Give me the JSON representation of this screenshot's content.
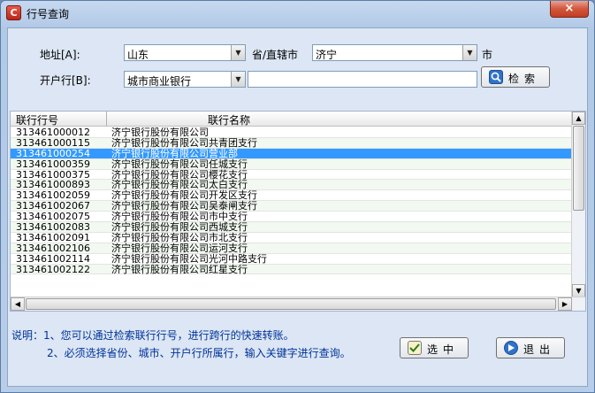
{
  "window": {
    "title": "行号查询",
    "app_icon_glyph": "C",
    "close_glyph": "×"
  },
  "form": {
    "address_label": "地址[A]:",
    "province_value": "山东",
    "province_suffix": "省/直辖市",
    "city_value": "济宁",
    "city_suffix": "市",
    "bank_label": "开户行[B]:",
    "bank_type_value": "城市商业银行",
    "keyword_value": "",
    "search_button": "检索"
  },
  "table": {
    "headers": [
      "联行行号",
      "联行名称"
    ],
    "selected_index": 2,
    "rows": [
      [
        "313461000012",
        "济宁银行股份有限公司"
      ],
      [
        "313461000115",
        "济宁银行股份有限公司共青团支行"
      ],
      [
        "313461000254",
        "济宁银行股份有限公司营业部"
      ],
      [
        "313461000359",
        "济宁银行股份有限公司任城支行"
      ],
      [
        "313461000375",
        "济宁银行股份有限公司樱花支行"
      ],
      [
        "313461000893",
        "济宁银行股份有限公司太白支行"
      ],
      [
        "313461002059",
        "济宁银行股份有限公司开发区支行"
      ],
      [
        "313461002067",
        "济宁银行股份有限公司吴泰闸支行"
      ],
      [
        "313461002075",
        "济宁银行股份有限公司市中支行"
      ],
      [
        "313461002083",
        "济宁银行股份有限公司西城支行"
      ],
      [
        "313461002091",
        "济宁银行股份有限公司市北支行"
      ],
      [
        "313461002106",
        "济宁银行股份有限公司运河支行"
      ],
      [
        "313461002114",
        "济宁银行股份有限公司光河中路支行"
      ],
      [
        "313461002122",
        "济宁银行股份有限公司红星支行"
      ]
    ]
  },
  "footer": {
    "note_line1": "说明：1、您可以通过检索联行行号，进行跨行的快速转账。",
    "note_line2": "2、必须选择省份、城市、开户行所属行，输入关键字进行查询。",
    "select_button": "选中",
    "exit_button": "退出"
  },
  "icons": {
    "search": "search-icon",
    "select": "check-icon",
    "exit": "exit-arrow-icon"
  },
  "colors": {
    "selection": "#3399ff",
    "alt_row": "#f1f9f0",
    "note_text": "#003399"
  }
}
